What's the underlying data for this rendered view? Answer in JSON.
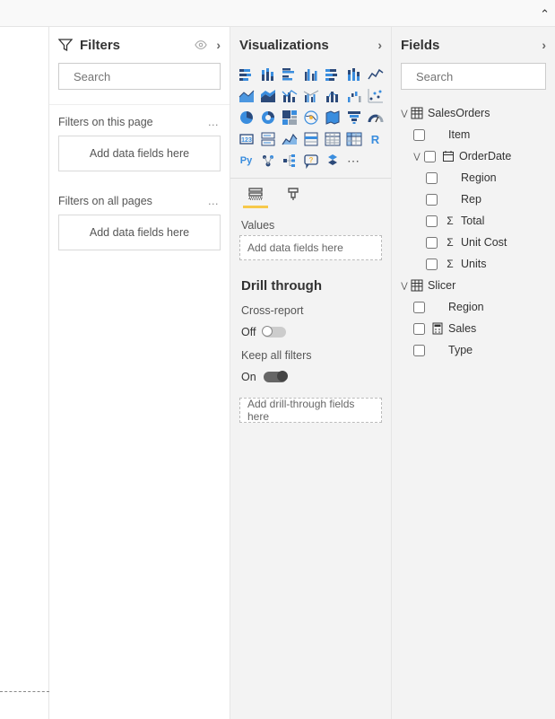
{
  "topbar": {
    "caret": "⌃"
  },
  "filters": {
    "title": "Filters",
    "search_placeholder": "Search",
    "page_label": "Filters on this page",
    "all_label": "Filters on all pages",
    "drop_text": "Add data fields here"
  },
  "viz": {
    "title": "Visualizations",
    "values_label": "Values",
    "values_drop": "Add data fields here",
    "drill_title": "Drill through",
    "cross_report_label": "Cross-report",
    "keep_all_label": "Keep all filters",
    "off_text": "Off",
    "on_text": "On",
    "drill_drop": "Add drill-through fields here",
    "icons": [
      "stacked-bar",
      "stacked-column",
      "clustered-bar",
      "clustered-column",
      "100-stacked-bar",
      "100-stacked-column",
      "line",
      "area",
      "stacked-area",
      "line-stacked-column",
      "line-clustered-column",
      "ribbon",
      "waterfall",
      "scatter",
      "pie",
      "donut",
      "treemap",
      "map",
      "filled-map",
      "funnel",
      "gauge",
      "card",
      "multi-row-card",
      "kpi",
      "slicer",
      "table",
      "matrix",
      "r-visual",
      "py-visual",
      "key-influencers",
      "decomposition-tree",
      "qna",
      "paginated",
      "more"
    ],
    "r_letter": "R",
    "py_letter": "Py",
    "more_letter": "⋯"
  },
  "fields": {
    "title": "Fields",
    "search_placeholder": "Search",
    "tables": [
      {
        "name": "SalesOrders",
        "expanded": true,
        "children": [
          {
            "name": "Item",
            "type": "text"
          },
          {
            "name": "OrderDate",
            "type": "date",
            "expanded": true,
            "children": [
              {
                "name": "Region",
                "type": "text"
              },
              {
                "name": "Rep",
                "type": "text"
              },
              {
                "name": "Total",
                "type": "sigma"
              },
              {
                "name": "Unit Cost",
                "type": "sigma"
              },
              {
                "name": "Units",
                "type": "sigma"
              }
            ]
          }
        ]
      },
      {
        "name": "Slicer",
        "expanded": true,
        "children": [
          {
            "name": "Region",
            "type": "text"
          },
          {
            "name": "Sales",
            "type": "calc"
          },
          {
            "name": "Type",
            "type": "text"
          }
        ]
      }
    ]
  }
}
